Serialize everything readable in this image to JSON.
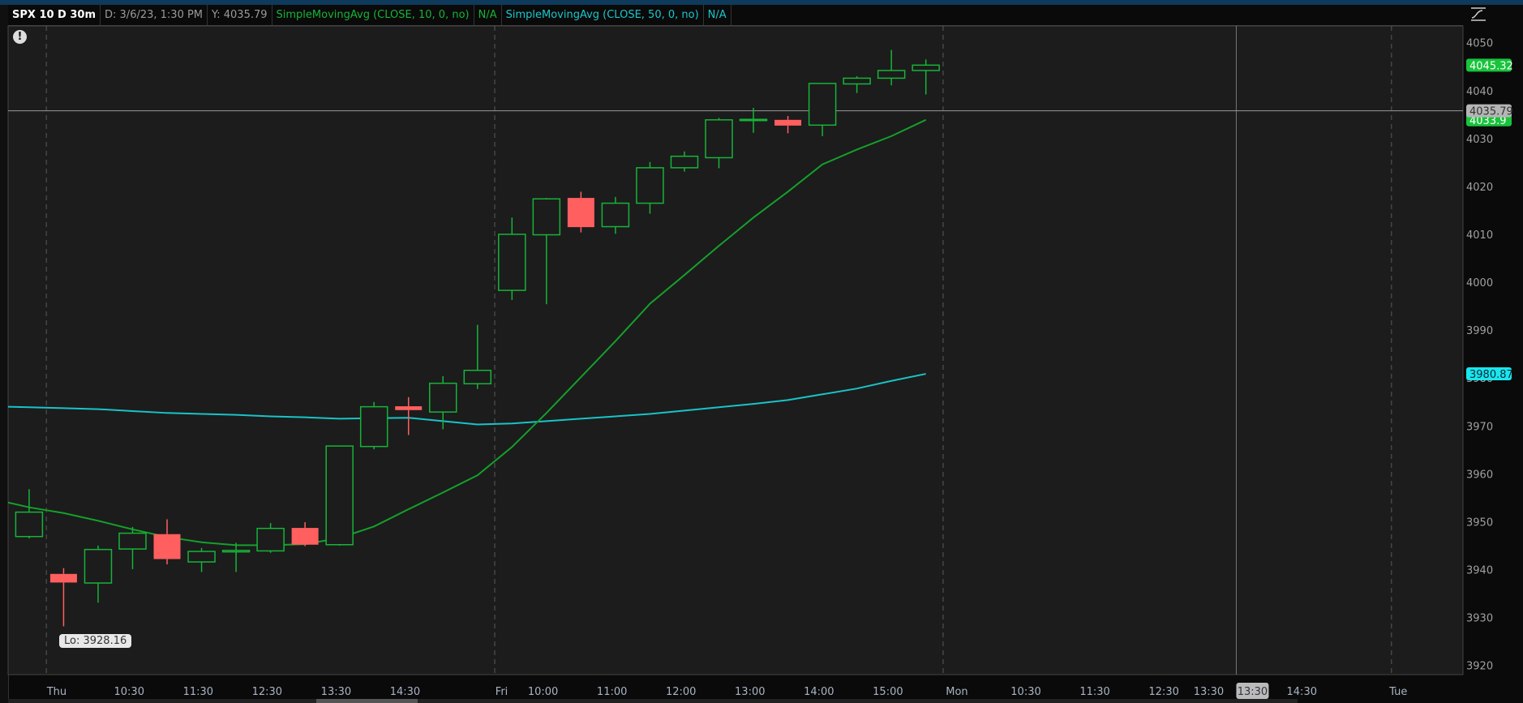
{
  "header": {
    "symbol": "SPX 10 D 30m",
    "date": "D: 3/6/23, 1:30 PM",
    "y_value": "Y: 4035.79",
    "sma10_label": "SimpleMovingAvg (CLOSE, 10, 0, no)",
    "sma10_value": "N/A",
    "sma50_label": "SimpleMovingAvg (CLOSE, 50, 0, no)",
    "sma50_value": "N/A"
  },
  "alert_icon": "!",
  "low_tooltip": "Lo: 3928.16",
  "colors": {
    "up": "#17b338",
    "down": "#ff5f5f",
    "sma10": "#14a02a",
    "sma50": "#19c3c8",
    "bg": "#1c1c1c"
  },
  "chart_data": {
    "type": "candlestick",
    "title": "SPX 10 D 30m",
    "ylim": [
      3915,
      4055
    ],
    "y_ticks": [
      4050,
      4040,
      4030,
      4020,
      4010,
      4000,
      3990,
      3980,
      3970,
      3960,
      3950,
      3940,
      3930,
      3920
    ],
    "candles": [
      {
        "t": "Wed 15:30",
        "o": 3946.9,
        "h": 3956.8,
        "l": 3946.5,
        "c": 3952.0
      },
      {
        "t": "Thu 9:30",
        "o": 3939.1,
        "h": 3940.3,
        "l": 3928.16,
        "c": 3937.3
      },
      {
        "t": "Thu 10:00",
        "o": 3937.2,
        "h": 3945.0,
        "l": 3933.1,
        "c": 3944.2
      },
      {
        "t": "Thu 10:30",
        "o": 3944.3,
        "h": 3948.9,
        "l": 3940.1,
        "c": 3947.6
      },
      {
        "t": "Thu 11:00",
        "o": 3947.4,
        "h": 3950.5,
        "l": 3941.1,
        "c": 3942.2
      },
      {
        "t": "Thu 11:30",
        "o": 3941.6,
        "h": 3944.5,
        "l": 3939.5,
        "c": 3943.8
      },
      {
        "t": "Thu 12:00",
        "o": 3943.7,
        "h": 3945.6,
        "l": 3939.5,
        "c": 3944.0
      },
      {
        "t": "Thu 12:30",
        "o": 3943.9,
        "h": 3949.7,
        "l": 3943.5,
        "c": 3948.6
      },
      {
        "t": "Thu 13:00",
        "o": 3948.7,
        "h": 3949.9,
        "l": 3944.9,
        "c": 3945.2
      },
      {
        "t": "Thu 13:30",
        "o": 3945.2,
        "h": 3965.9,
        "l": 3945.0,
        "c": 3965.8
      },
      {
        "t": "Thu 14:00",
        "o": 3965.7,
        "h": 3975.0,
        "l": 3965.1,
        "c": 3974.0
      },
      {
        "t": "Thu 14:30",
        "o": 3974.1,
        "h": 3976.0,
        "l": 3968.1,
        "c": 3973.3
      },
      {
        "t": "Thu 15:00",
        "o": 3972.9,
        "h": 3980.4,
        "l": 3969.3,
        "c": 3978.9
      },
      {
        "t": "Thu 15:30",
        "o": 3978.8,
        "h": 3991.1,
        "l": 3977.7,
        "c": 3981.6
      },
      {
        "t": "Fri 9:30",
        "o": 3998.3,
        "h": 4013.5,
        "l": 3996.3,
        "c": 4010.0
      },
      {
        "t": "Fri 10:00",
        "o": 4009.9,
        "h": 4017.6,
        "l": 3995.4,
        "c": 4017.4
      },
      {
        "t": "Fri 10:30",
        "o": 4017.6,
        "h": 4018.9,
        "l": 4010.4,
        "c": 4011.5
      },
      {
        "t": "Fri 11:00",
        "o": 4011.6,
        "h": 4017.8,
        "l": 4010.1,
        "c": 4016.5
      },
      {
        "t": "Fri 11:30",
        "o": 4016.5,
        "h": 4025.1,
        "l": 4014.3,
        "c": 4023.9
      },
      {
        "t": "Fri 12:00",
        "o": 4023.9,
        "h": 4027.3,
        "l": 4023.1,
        "c": 4026.3
      },
      {
        "t": "Fri 12:30",
        "o": 4026.0,
        "h": 4034.3,
        "l": 4023.8,
        "c": 4033.9
      },
      {
        "t": "Fri 13:00",
        "o": 4033.8,
        "h": 4036.4,
        "l": 4031.2,
        "c": 4034.0
      },
      {
        "t": "Fri 13:30",
        "o": 4033.9,
        "h": 4034.7,
        "l": 4031.1,
        "c": 4032.7
      },
      {
        "t": "Fri 14:00",
        "o": 4032.8,
        "h": 4041.5,
        "l": 4030.5,
        "c": 4041.5
      },
      {
        "t": "Fri 14:30",
        "o": 4041.4,
        "h": 4043.0,
        "l": 4039.5,
        "c": 4042.6
      },
      {
        "t": "Fri 15:00",
        "o": 4042.6,
        "h": 4048.5,
        "l": 4041.1,
        "c": 4044.2
      },
      {
        "t": "Fri 15:30",
        "o": 4044.2,
        "h": 4046.5,
        "l": 4039.2,
        "c": 4045.32
      }
    ],
    "series": [
      {
        "name": "SimpleMovingAvg (CLOSE, 10, 0, no)",
        "start": 3954.0,
        "values": [
          3953.0,
          3951.8,
          3950.2,
          3948.4,
          3946.8,
          3945.7,
          3945.1,
          3945.1,
          3945.3,
          3946.6,
          3949.0,
          3952.6,
          3956.1,
          3959.7,
          3965.6,
          3972.7,
          3980.2,
          3987.7,
          3995.5,
          4001.5,
          4007.6,
          4013.5,
          4018.9,
          4024.6,
          4027.7,
          4030.5,
          4033.9
        ]
      },
      {
        "name": "SimpleMovingAvg (CLOSE, 50, 0, no)",
        "start": 3974.0,
        "values": [
          3973.9,
          3973.7,
          3973.5,
          3973.1,
          3972.7,
          3972.5,
          3972.3,
          3972.0,
          3971.8,
          3971.5,
          3971.6,
          3971.7,
          3971.0,
          3970.3,
          3970.5,
          3971.0,
          3971.5,
          3972.0,
          3972.5,
          3973.2,
          3973.9,
          3974.6,
          3975.4,
          3976.6,
          3977.8,
          3979.4,
          3980.87
        ]
      }
    ],
    "price_labels": [
      {
        "text": "4045.32",
        "value": 4045.32,
        "kind": "last"
      },
      {
        "text": "4033.9",
        "value": 4033.9,
        "kind": "sma10"
      },
      {
        "text": "4035.79",
        "value": 4035.79,
        "kind": "cursor"
      },
      {
        "text": "3980.87",
        "value": 3980.87,
        "kind": "sma50"
      }
    ],
    "x_labels": [
      {
        "label": "Thu",
        "bar": 0.8
      },
      {
        "label": "10:30",
        "bar": 2.9
      },
      {
        "label": "11:30",
        "bar": 4.9
      },
      {
        "label": "12:30",
        "bar": 6.9
      },
      {
        "label": "13:30",
        "bar": 8.9
      },
      {
        "label": "14:30",
        "bar": 10.9
      },
      {
        "label": "Fri",
        "bar": 13.7
      },
      {
        "label": "10:00",
        "bar": 14.9
      },
      {
        "label": "11:00",
        "bar": 16.9
      },
      {
        "label": "12:00",
        "bar": 18.9
      },
      {
        "label": "13:00",
        "bar": 20.9
      },
      {
        "label": "14:00",
        "bar": 22.9
      },
      {
        "label": "15:00",
        "bar": 24.9
      },
      {
        "label": "Mon",
        "bar": 26.9
      },
      {
        "label": "10:30",
        "bar": 28.9
      },
      {
        "label": "11:30",
        "bar": 30.9
      },
      {
        "label": "12:30",
        "bar": 32.9
      },
      {
        "label": "13:30",
        "bar": 34.2
      },
      {
        "label": "14:30",
        "bar": 36.9
      },
      {
        "label": "Tue",
        "bar": 39.7
      }
    ],
    "day_dividers": [
      0.5,
      13.5,
      26.5,
      39.5
    ],
    "crosshair": {
      "bar": 35,
      "price": 4035.79,
      "time_label": "13:30"
    }
  }
}
